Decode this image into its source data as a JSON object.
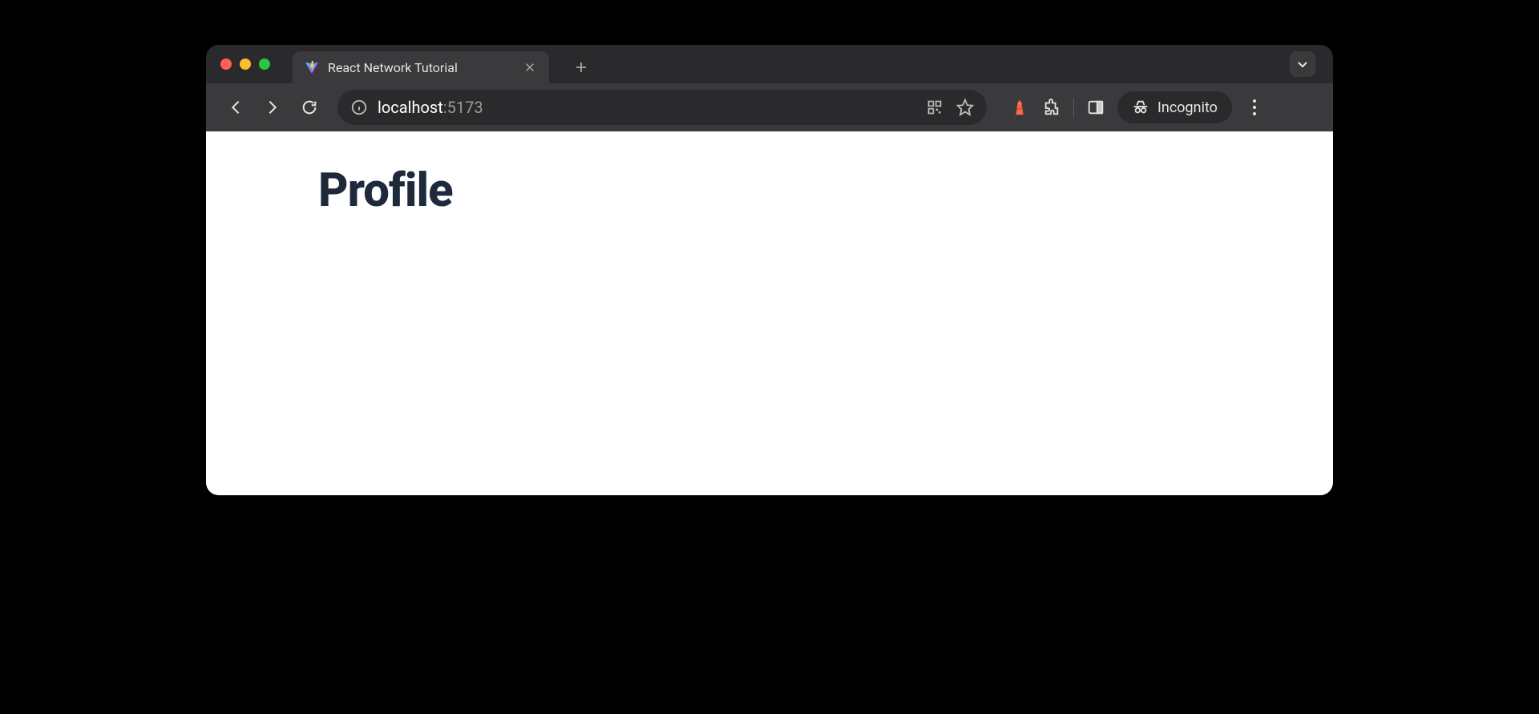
{
  "titlebar": {
    "tab": {
      "title": "React Network Tutorial"
    }
  },
  "toolbar": {
    "address": {
      "host": "localhost",
      "port": ":5173"
    },
    "incognito_label": "Incognito"
  },
  "page": {
    "heading": "Profile"
  }
}
